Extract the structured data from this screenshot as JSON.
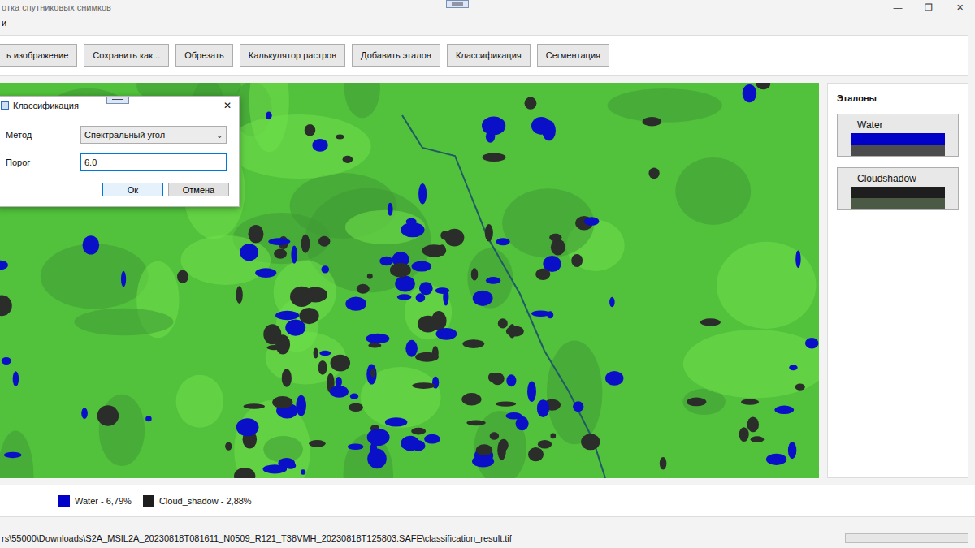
{
  "window": {
    "title": "отка спутниковых снимков",
    "controls": [
      "—",
      "❐",
      "✕"
    ]
  },
  "menu": [
    "и"
  ],
  "toolbar": [
    "ь изображение",
    "Сохранить как...",
    "Обрезать",
    "Калькулятор растров",
    "Добавить эталон",
    "Классификация",
    "Сегментация"
  ],
  "references": {
    "title": "Эталоны",
    "items": [
      {
        "name": "Water",
        "color": "#0000c8",
        "secondary_color": "#4c4c4c"
      },
      {
        "name": "Cloudshadow",
        "color": "#1e1e1e",
        "secondary_color": "#4a5a45"
      }
    ]
  },
  "dialog": {
    "title": "Классификация",
    "close": "✕",
    "fields": [
      {
        "kind": "select",
        "label": "Метод",
        "value": "Спектральный угол",
        "arrow": "⌄",
        "focused": false
      },
      {
        "kind": "input",
        "label": "Порог",
        "value": "6.0",
        "focused": true
      }
    ],
    "buttons": [
      {
        "label": "Ок",
        "default": true
      },
      {
        "label": "Отмена",
        "default": false
      }
    ]
  },
  "legend": [
    {
      "label": "Water - 6,79%",
      "color": "#0000c8"
    },
    {
      "label": "Cloud_shadow - 2,88%",
      "color": "#1e1e1e"
    }
  ],
  "status_bar": {
    "path": "rs\\55000\\Downloads\\S2A_MSIL2A_20230818T081611_N0509_R121_T38VMH_20230818T125803.SAFE\\classification_result.tif",
    "progress": {
      "level": 0
    }
  }
}
